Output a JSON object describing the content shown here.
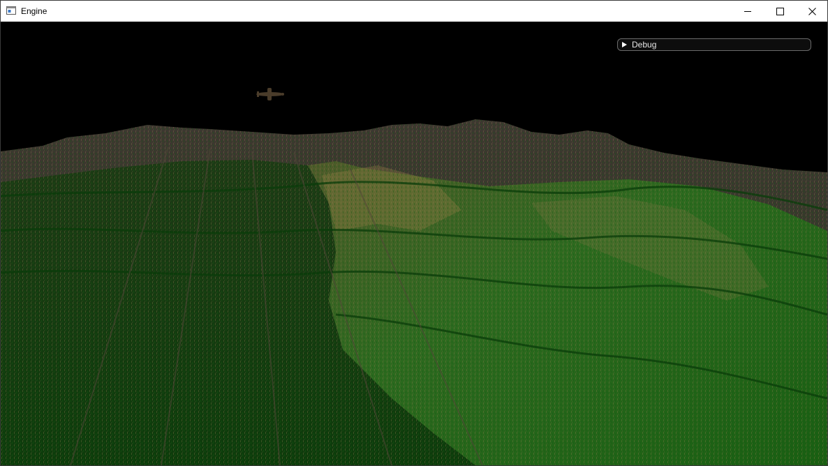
{
  "window": {
    "title": "Engine",
    "icon": "app-window-icon",
    "controls": [
      "minimize-icon",
      "maximize-icon",
      "close-icon"
    ]
  },
  "debug": {
    "label": "Debug",
    "state": "collapsed",
    "icon": "triangle-right-icon"
  },
  "scene": {
    "sky_color": "#000000",
    "terrain_colors": [
      "#0f3f0d",
      "#1f6b17",
      "#5a4c3a",
      "#a08450"
    ],
    "contains": [
      "terrain",
      "airplane"
    ]
  }
}
